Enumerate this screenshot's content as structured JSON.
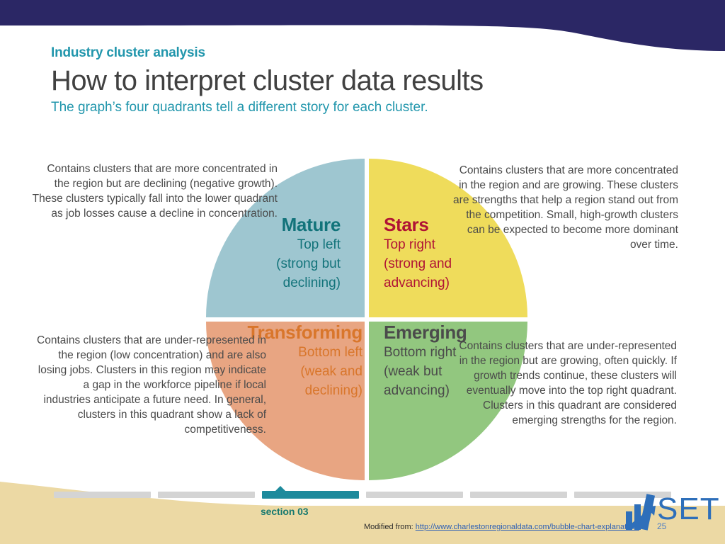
{
  "slide": {
    "eyebrow": "Industry cluster analysis",
    "title": "How to interpret cluster data results",
    "subtitle": "The graph’s four quadrants tell a different story for each cluster."
  },
  "colors": {
    "banner_navy": "#2b2765",
    "beige": "#ecd9a4",
    "teal_accent": "#2196ac",
    "mature_fill": "#9ec6d0",
    "stars_fill": "#efdc5b",
    "transforming_fill": "#e8a582",
    "emerging_fill": "#92c77f",
    "mature_text": "#12737a",
    "stars_text": "#b01335",
    "transforming_text": "#d9762b",
    "emerging_text": "#4b4b4b"
  },
  "quadrants": [
    {
      "key": "mature",
      "title": "Mature",
      "subtitle": "Top left\n(strong but\ndeclining)",
      "position": "top-left",
      "description": "Contains clusters that are more concentrated in the region but are declining (negative growth). These clusters typically fall into the lower quadrant as job losses cause a decline in concentration."
    },
    {
      "key": "stars",
      "title": "Stars",
      "subtitle": "Top right\n(strong and\nadvancing)",
      "position": "top-right",
      "description": "Contains clusters that are more concentrated in the region and are growing. These clusters are strengths that help a region stand out from the competition. Small, high-growth clusters can be expected to become more dominant over time."
    },
    {
      "key": "transforming",
      "title": "Transforming",
      "subtitle": "Bottom left\n(weak and\ndeclining)",
      "position": "bottom-left",
      "description": "Contains clusters that are under-represented in the region (low concentration) and are also losing jobs. Clusters in this region may indicate a gap in the workforce pipeline if local industries anticipate a future need. In general, clusters in this quadrant show a lack of competitiveness."
    },
    {
      "key": "emerging",
      "title": "Emerging",
      "subtitle": "Bottom right\n(weak but\nadvancing)",
      "position": "bottom-right",
      "description": "Contains clusters that are under-represented in the region but are growing, often quickly. If growth trends continue, these clusters will eventually move into the top right quadrant. Clusters in this quadrant are considered emerging strengths for the region."
    }
  ],
  "footer": {
    "section_label": "section 03",
    "progress_total": 6,
    "progress_active_index": 3,
    "attribution_prefix": "Modified from: ",
    "attribution_url": "http://www.charlestonregionaldata.com/bubble-chart-explanation/",
    "page_number": "25",
    "logo_text": "SET"
  }
}
